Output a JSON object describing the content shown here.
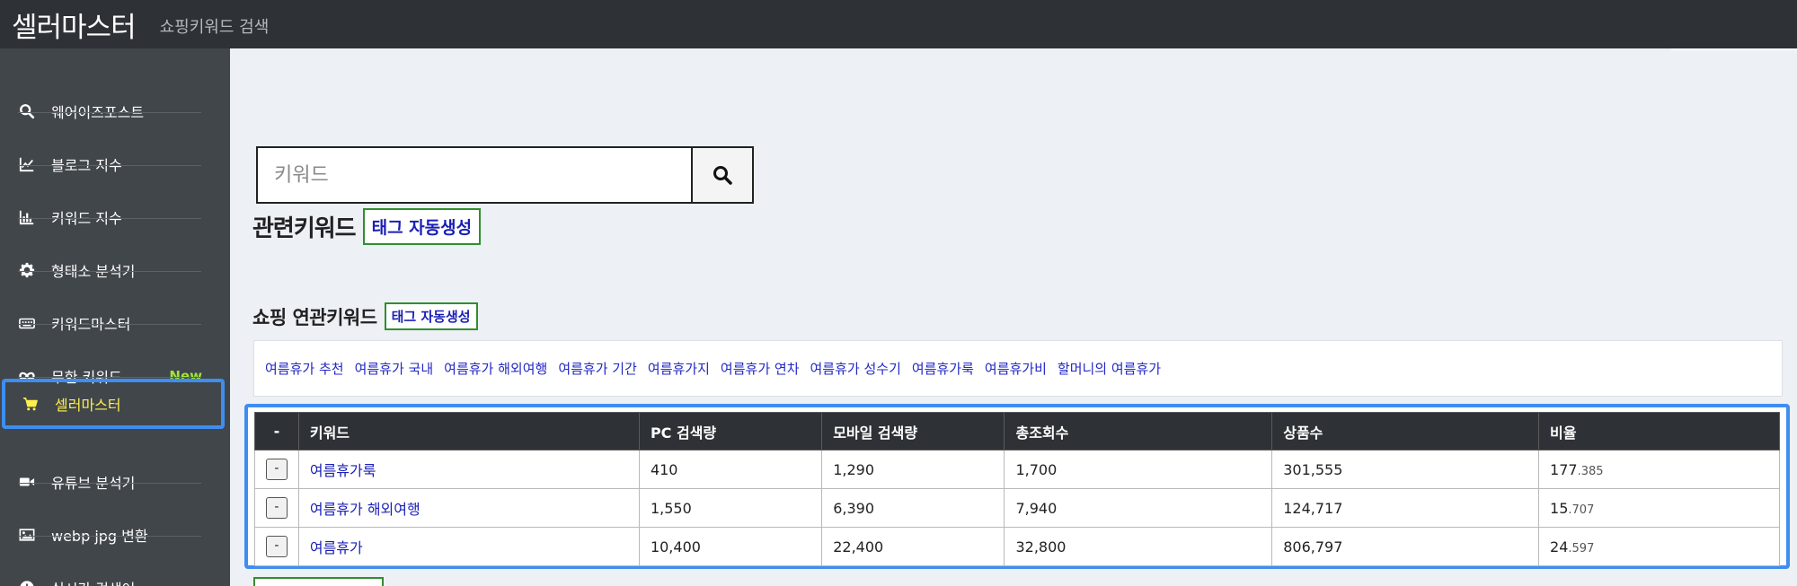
{
  "header": {
    "brand": "셀러마스터",
    "subtitle": "쇼핑키워드 검색"
  },
  "sidebar": {
    "items": [
      {
        "icon": "search-icon",
        "label": "웨어이즈포스트"
      },
      {
        "icon": "line-chart-icon",
        "label": "블로그 지수"
      },
      {
        "icon": "bar-chart-icon",
        "label": "키워드 지수"
      },
      {
        "icon": "gear-icon",
        "label": "형태소 분석기"
      },
      {
        "icon": "keyboard-icon",
        "label": "키워드마스터"
      },
      {
        "icon": "infinity-icon",
        "label": "무한 키워드",
        "badge": "New"
      },
      {
        "icon": "cart-icon",
        "label": "셀러마스터",
        "active": true
      },
      {
        "icon": "video-icon",
        "label": "유튜브 분석기"
      },
      {
        "icon": "image-icon",
        "label": "webp jpg 변환"
      },
      {
        "icon": "clock-icon",
        "label": "실시간 검색어"
      }
    ]
  },
  "search": {
    "placeholder": "키워드",
    "value": ""
  },
  "related": {
    "title": "관련키워드",
    "tag_button": "태그 자동생성"
  },
  "shopping": {
    "title": "쇼핑 연관키워드",
    "tag_button": "태그 자동생성",
    "keywords": [
      "여름휴가 추천",
      "여름휴가 국내",
      "여름휴가 해외여행",
      "여름휴가 기간",
      "여름휴가지",
      "여름휴가 연차",
      "여름휴가 성수기",
      "여름휴가룩",
      "여름휴가비",
      "할머니의 여름휴가"
    ]
  },
  "table": {
    "headers": [
      "-",
      "키워드",
      "PC 검색량",
      "모바일 검색량",
      "총조회수",
      "상품수",
      "비율"
    ],
    "rows": [
      {
        "btn": "-",
        "keyword": "여름휴가룩",
        "pc": "410",
        "mobile": "1,290",
        "total": "1,700",
        "products": "301,555",
        "ratio_int": "177",
        "ratio_dec": ".385"
      },
      {
        "btn": "-",
        "keyword": "여름휴가 해외여행",
        "pc": "1,550",
        "mobile": "6,390",
        "total": "7,940",
        "products": "124,717",
        "ratio_int": "15",
        "ratio_dec": ".707"
      },
      {
        "btn": "-",
        "keyword": "여름휴가",
        "pc": "10,400",
        "mobile": "22,400",
        "total": "32,800",
        "products": "806,797",
        "ratio_int": "24",
        "ratio_dec": ".597"
      }
    ]
  },
  "colors": {
    "topbar": "#2e3236",
    "sidebar": "#41464b",
    "active_text": "#fff04d",
    "highlight_border": "#3e8ef0",
    "new_badge": "#9ee53b",
    "link": "#1a1fb5"
  }
}
